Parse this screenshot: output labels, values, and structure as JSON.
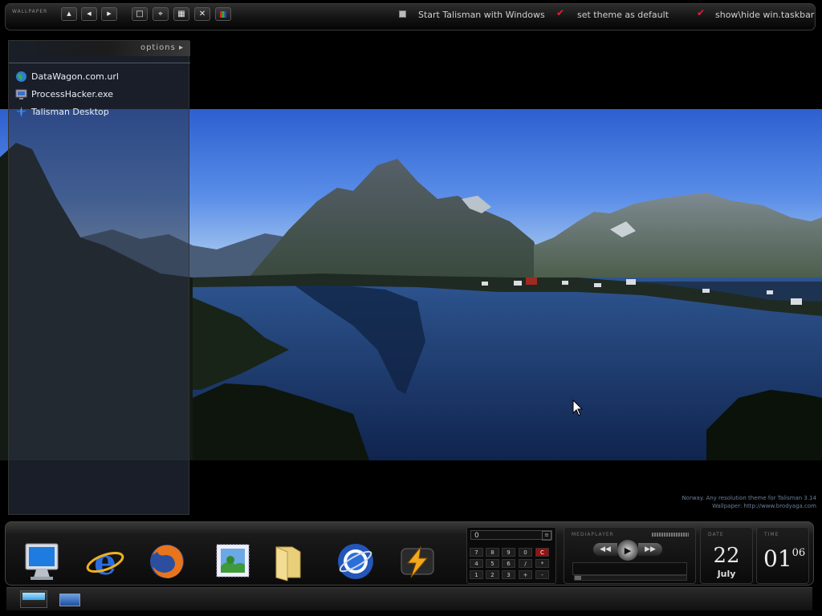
{
  "topbar": {
    "title": "WALLPAPER",
    "nav_buttons": [
      {
        "icon": "up-arrow-icon",
        "glyph": "▲"
      },
      {
        "icon": "left-arrow-icon",
        "glyph": "◀"
      },
      {
        "icon": "right-arrow-icon",
        "glyph": "▶"
      }
    ],
    "tool_buttons": [
      {
        "icon": "stop-icon",
        "glyph": "□"
      },
      {
        "icon": "crosshair-icon",
        "glyph": "⌖"
      },
      {
        "icon": "grid-icon",
        "glyph": "▦"
      },
      {
        "icon": "close-icon",
        "glyph": "✕"
      },
      {
        "icon": "color-palette-icon",
        "glyph": "▮"
      }
    ],
    "options": [
      {
        "label": "Start Talisman with Windows",
        "checked": false
      },
      {
        "label": "set theme as default",
        "checked": true
      },
      {
        "label": "show\\hide win.taskbar",
        "checked": true
      }
    ]
  },
  "panel": {
    "options_label": "options ▸",
    "items": [
      {
        "label": "DataWagon.com.url",
        "icon": "globe-icon"
      },
      {
        "label": "ProcessHacker.exe",
        "icon": "monitor-icon"
      },
      {
        "label": "Talisman Desktop",
        "icon": "talisman-icon"
      }
    ]
  },
  "credit": {
    "line1": "Norway. Any resolution theme for Talisman 3.14",
    "line2": "Wallpaper:  http://www.brodyaga.com"
  },
  "dock": {
    "icons": [
      "my-computer-icon",
      "internet-explorer-icon",
      "firefox-icon",
      "mail-stamp-icon",
      "folder-icon",
      "google-earth-icon",
      "winamp-icon"
    ],
    "calculator": {
      "display": "0",
      "keys": [
        "7",
        "8",
        "9",
        "0",
        "C",
        "4",
        "5",
        "6",
        "/",
        "*",
        ".",
        "1",
        "2",
        "3",
        "+",
        "-",
        "%"
      ]
    },
    "media": {
      "label": "MEDIAPLAYER"
    },
    "date": {
      "label": "DATE",
      "day": "22",
      "month": "July"
    },
    "time": {
      "label": "TIME",
      "hour": "01",
      "minute": "06"
    }
  },
  "colors": {
    "accent_red": "#e0213a",
    "panel": "#2d3748"
  }
}
